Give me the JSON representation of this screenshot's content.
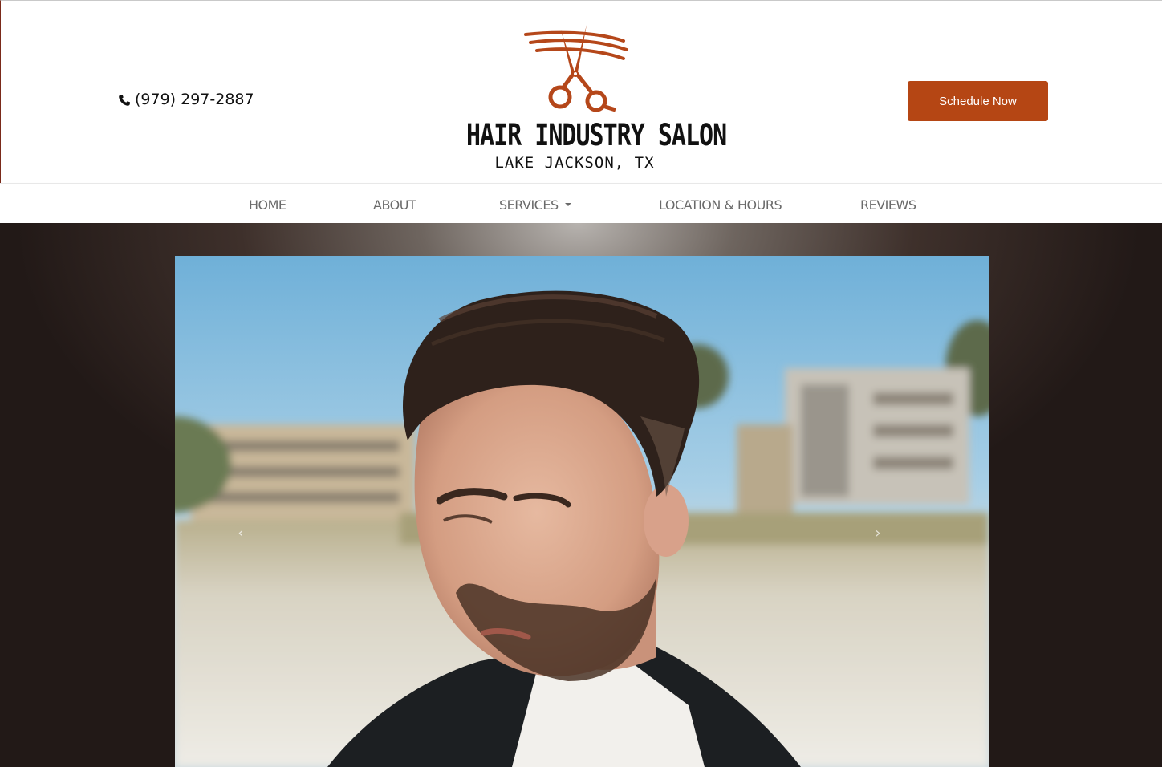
{
  "header": {
    "phone": "(979) 297-2887",
    "logo_title": "HAIR INDUSTRY SALON",
    "logo_subtitle": "LAKE JACKSON, TX",
    "cta_label": "Schedule Now"
  },
  "nav": {
    "items": [
      {
        "label": "Home"
      },
      {
        "label": "About"
      },
      {
        "label": "Services"
      },
      {
        "label": "Location & Hours"
      },
      {
        "label": "Reviews"
      }
    ]
  },
  "carousel": {
    "prev_glyph": "‹",
    "next_glyph": "›",
    "image_alt": "man-with-pompadour-haircut-photo"
  },
  "colors": {
    "brand_orange": "#b54614",
    "logo_orange": "#b5471a",
    "nav_text": "#6a6a6a"
  },
  "icons": {
    "phone": "phone-icon",
    "logo": "scissors-logo-icon",
    "dropdown": "chevron-down-icon"
  }
}
